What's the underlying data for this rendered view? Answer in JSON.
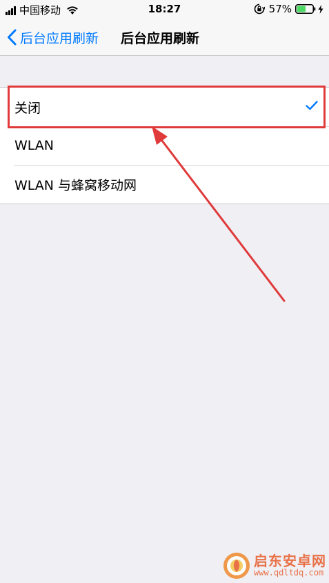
{
  "status_bar": {
    "carrier": "中国移动",
    "time": "18:27",
    "battery_percent": "57%",
    "battery_level": 0.57
  },
  "nav": {
    "back_label": "后台应用刷新",
    "title": "后台应用刷新"
  },
  "options": [
    {
      "label": "关闭",
      "selected": true
    },
    {
      "label": "WLAN",
      "selected": false
    },
    {
      "label": "WLAN 与蜂窝移动网",
      "selected": false
    }
  ],
  "watermark": {
    "name": "启东安卓网",
    "url": "www.qdltdq.com"
  },
  "colors": {
    "accent": "#007aff",
    "annotation": "#e03a3a",
    "background": "#efeff4"
  }
}
